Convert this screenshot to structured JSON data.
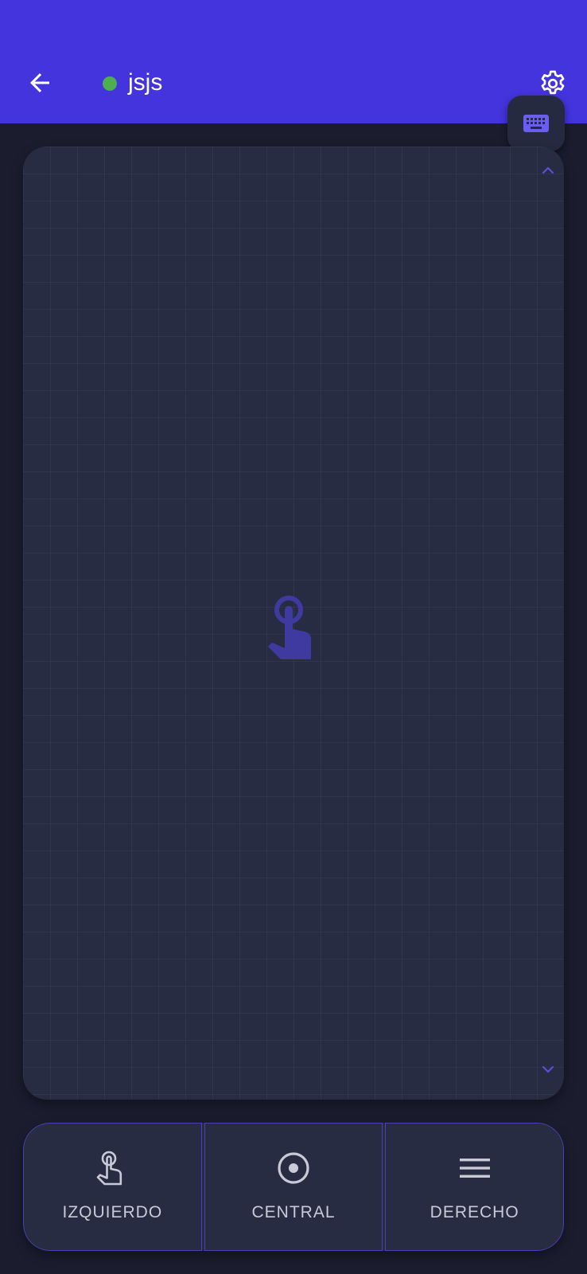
{
  "header": {
    "device_name": "jsjs",
    "status": "connected",
    "status_color": "#4caf50",
    "bar_color": "#4434dd"
  },
  "touchpad": {
    "background_color": "#272c43",
    "hint_icon": "touch-app-icon"
  },
  "mouse_buttons": [
    {
      "label": "IZQUIERDO",
      "icon": "touch-app-icon"
    },
    {
      "label": "CENTRAL",
      "icon": "radio-button-icon"
    },
    {
      "label": "DERECHO",
      "icon": "menu-icon"
    }
  ],
  "accent_color": "#5a4fd6"
}
